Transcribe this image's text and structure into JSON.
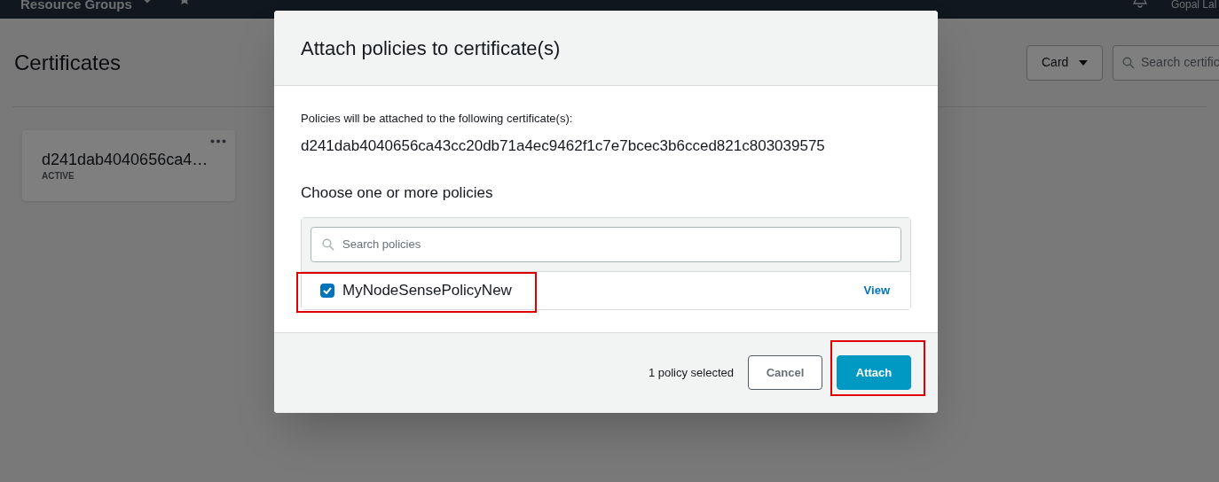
{
  "top_bar": {
    "menu_label": "Resource Groups",
    "user": "Gopal Lal"
  },
  "page": {
    "title": "Certificates",
    "view_select": "Card",
    "search": {
      "placeholder": "Search certific"
    }
  },
  "cards": [
    {
      "title": "d241dab4040656ca4…",
      "status": "ACTIVE"
    }
  ],
  "dialog": {
    "title": "Attach policies to certificate(s)",
    "intro": "Policies will be attached to the following certificate(s):",
    "certificate_id": "d241dab4040656ca43cc20db71a4ec9462f1c7e7bcec3b6cced821c803039575",
    "section_title": "Choose one or more policies",
    "search": {
      "placeholder": "Search policies"
    },
    "policies": [
      {
        "name": "MyNodeSensePolicyNew",
        "checked": true,
        "highlighted": true,
        "link": "View"
      }
    ],
    "selection_count": "1 policy selected",
    "buttons": [
      {
        "label": "Cancel",
        "kind": "secondary",
        "highlighted": false
      },
      {
        "label": "Attach",
        "kind": "primary",
        "highlighted": true
      }
    ]
  }
}
